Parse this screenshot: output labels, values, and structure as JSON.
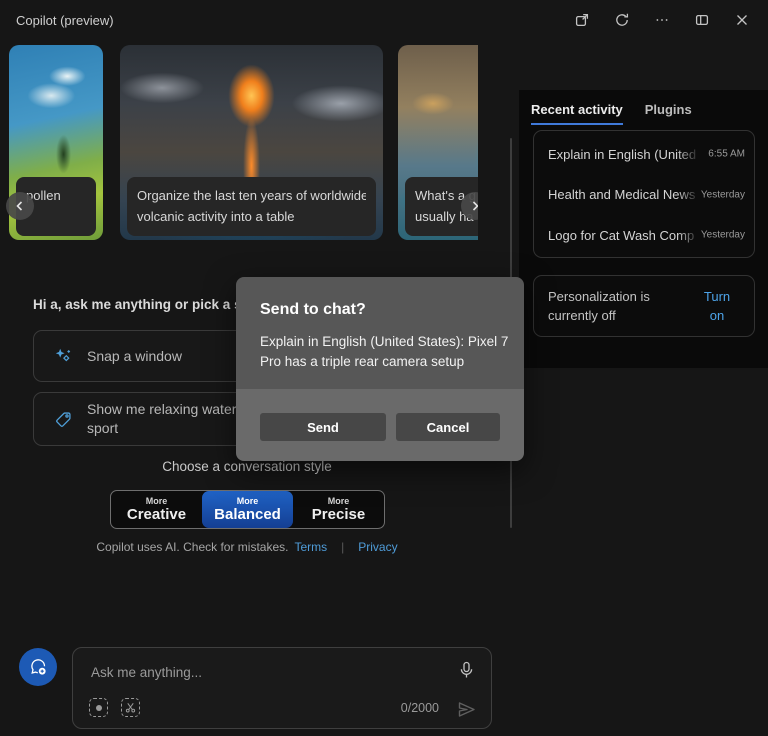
{
  "titlebar": {
    "title": "Copilot (preview)",
    "icons": [
      "open-external",
      "refresh",
      "more-options",
      "split-view",
      "close"
    ]
  },
  "carousel": {
    "cards": [
      {
        "caption": "pollen",
        "image": "tropical-beach-palm"
      },
      {
        "caption_lines": [
          "Organize the last ten years of worldwide",
          "volcanic activity into a table"
        ],
        "image": "volcano-eruption"
      },
      {
        "caption_lines": [
          "What's a g",
          "usually ha"
        ],
        "image": "water-slide"
      }
    ]
  },
  "right_panel": {
    "tabs": [
      {
        "label": "Recent activity",
        "active": true
      },
      {
        "label": "Plugins",
        "active": false
      }
    ],
    "history": [
      {
        "title": "Explain in English (United S",
        "time": "6:55 AM"
      },
      {
        "title": "Health and Medical News",
        "time": "Yesterday"
      },
      {
        "title": "Logo for Cat Wash Comp",
        "time": "Yesterday"
      }
    ],
    "personalization": {
      "text": "Personalization is currently off",
      "action": "Turn on"
    }
  },
  "main": {
    "greeting": "Hi a, ask me anything or pick a sug",
    "suggestions": [
      {
        "label": "Snap a window",
        "icon": "sparkle"
      },
      {
        "label": "Show me relaxing water sport",
        "icon": "tag"
      }
    ],
    "style_label": "Choose a conversation style",
    "styles": [
      {
        "top": "More",
        "bottom": "Creative",
        "selected": false
      },
      {
        "top": "More",
        "bottom": "Balanced",
        "selected": true
      },
      {
        "top": "More",
        "bottom": "Precise",
        "selected": false
      }
    ],
    "disclaimer": "Copilot uses AI. Check for mistakes.",
    "terms_link": "Terms",
    "privacy_link": "Privacy"
  },
  "dialog": {
    "title": "Send to chat?",
    "body_lines": [
      "Explain in English (United States): Pixel 7",
      "Pro has a triple rear camera setup"
    ],
    "send_label": "Send",
    "cancel_label": "Cancel"
  },
  "composer": {
    "placeholder": "Ask me anything...",
    "counter": "0/2000"
  },
  "colors": {
    "accent_blue": "#1d5fbf",
    "link_blue": "#4da3e8",
    "tab_underline": "#3f79d9",
    "background": "#161616",
    "panel_black": "#0a0a0a",
    "dialog_gray": "#575757"
  }
}
